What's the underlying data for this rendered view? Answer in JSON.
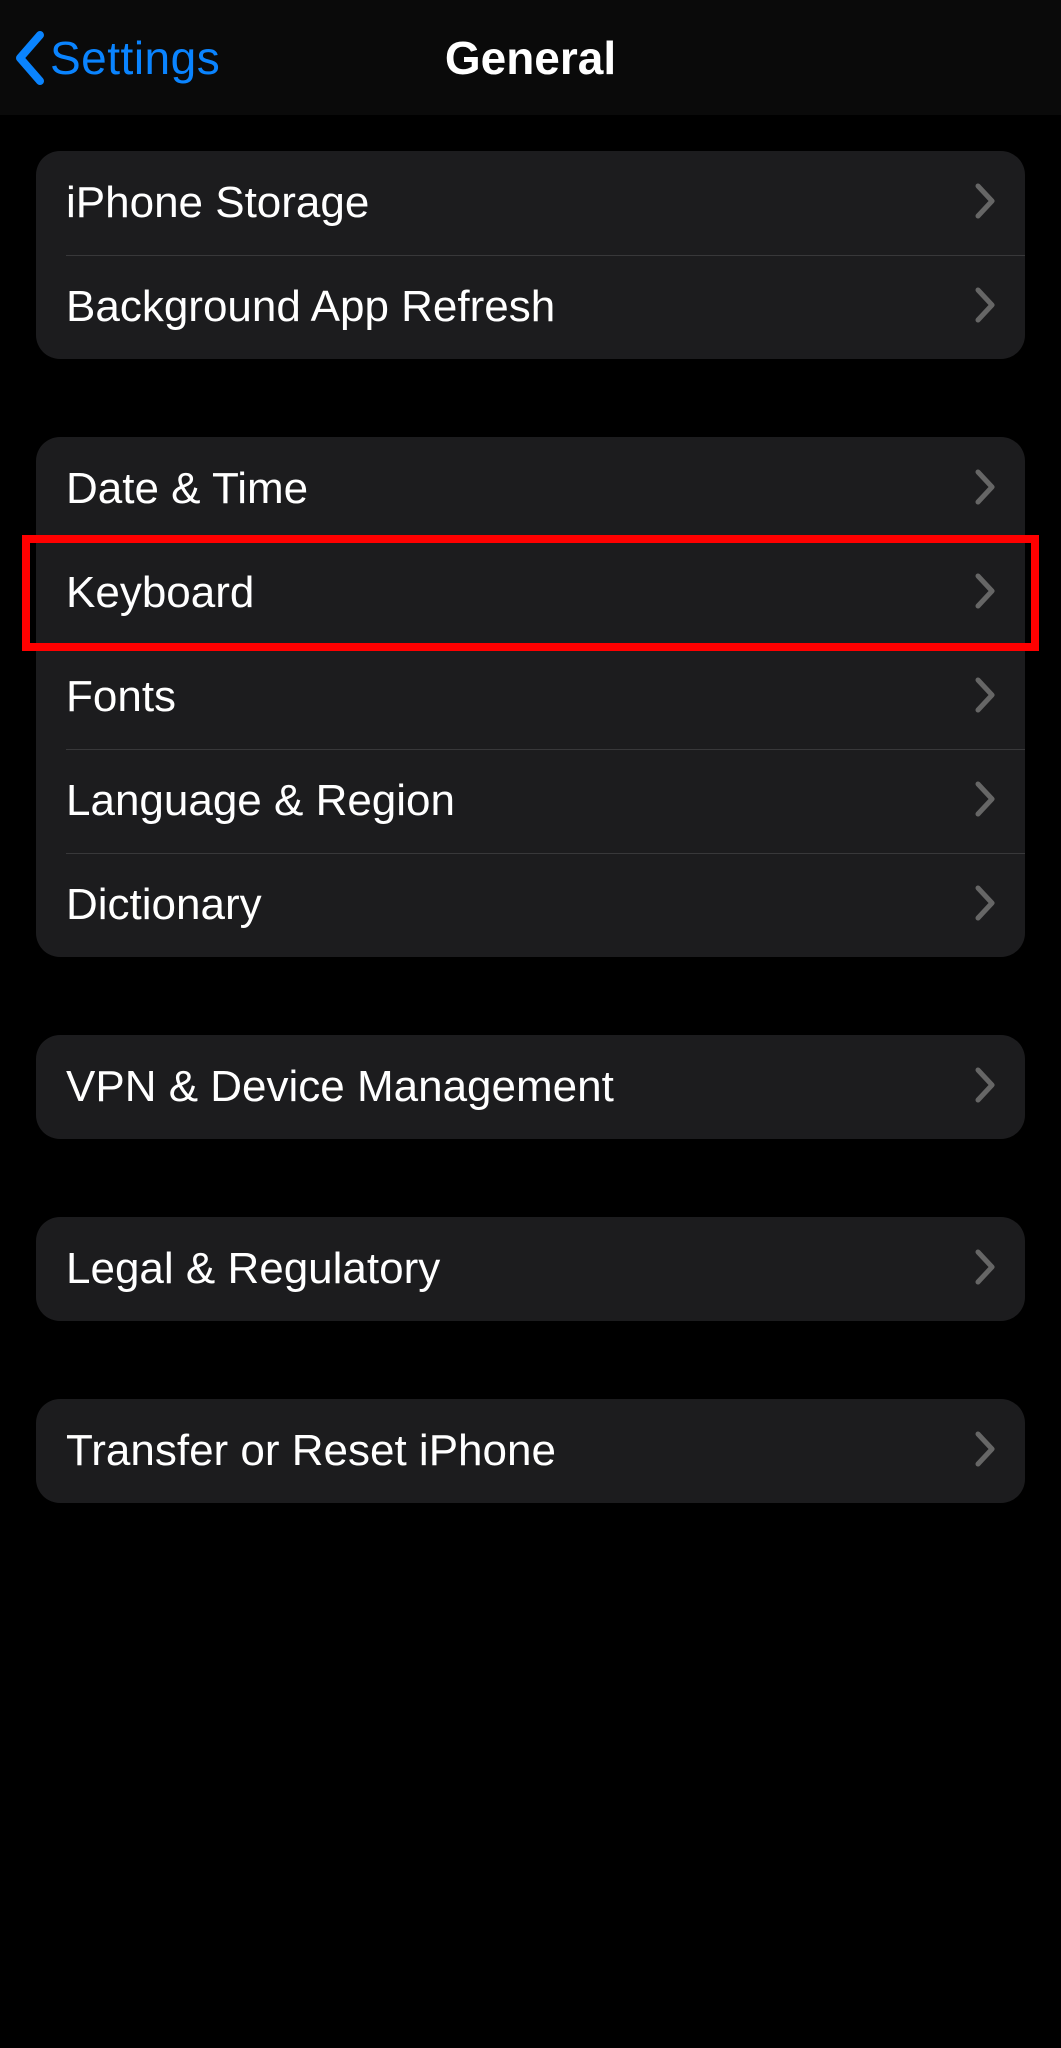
{
  "nav": {
    "back_label": "Settings",
    "title": "General"
  },
  "groups": [
    {
      "rows": [
        {
          "id": "iphone-storage",
          "label": "iPhone Storage"
        },
        {
          "id": "background-app-refresh",
          "label": "Background App Refresh"
        }
      ]
    },
    {
      "rows": [
        {
          "id": "date-time",
          "label": "Date & Time"
        },
        {
          "id": "keyboard",
          "label": "Keyboard",
          "highlighted": true
        },
        {
          "id": "fonts",
          "label": "Fonts"
        },
        {
          "id": "language-region",
          "label": "Language & Region"
        },
        {
          "id": "dictionary",
          "label": "Dictionary"
        }
      ]
    },
    {
      "rows": [
        {
          "id": "vpn-device-management",
          "label": "VPN & Device Management"
        }
      ]
    },
    {
      "rows": [
        {
          "id": "legal-regulatory",
          "label": "Legal & Regulatory"
        }
      ]
    },
    {
      "rows": [
        {
          "id": "transfer-reset",
          "label": "Transfer or Reset iPhone"
        }
      ]
    }
  ],
  "annotation": {
    "highlight_color": "#ff0000"
  }
}
